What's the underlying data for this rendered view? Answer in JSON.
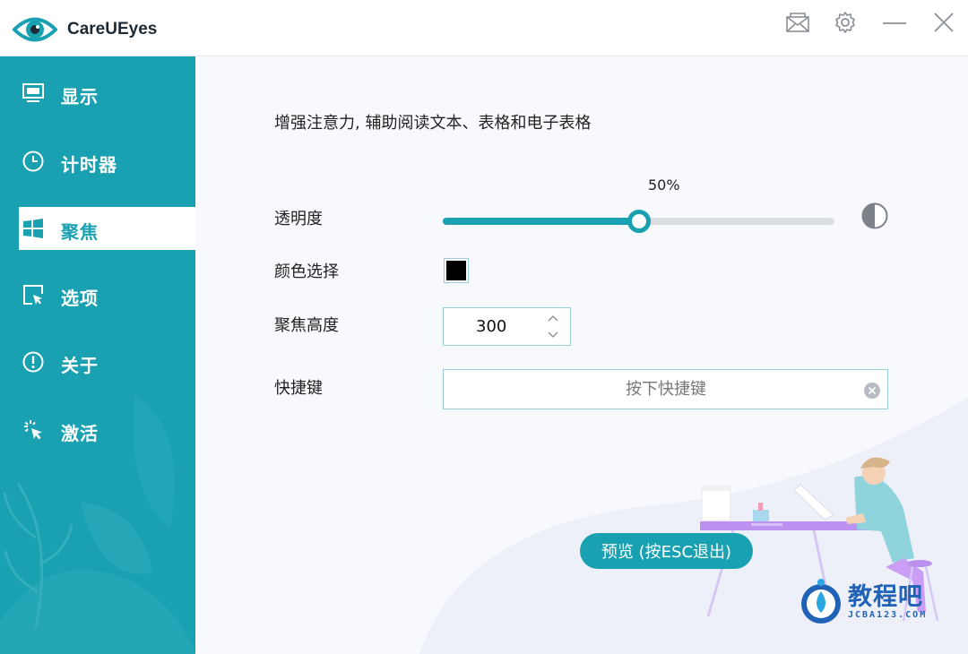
{
  "app": {
    "title": "CareUEyes"
  },
  "titlebar": {
    "icons": [
      "mail-icon",
      "gear-icon",
      "minimize-icon",
      "close-icon"
    ]
  },
  "sidebar": {
    "items": [
      {
        "label": "显示",
        "icon": "monitor-icon",
        "active": false
      },
      {
        "label": "计时器",
        "icon": "clock-icon",
        "active": false
      },
      {
        "label": "聚焦",
        "icon": "windows-icon",
        "active": true
      },
      {
        "label": "选项",
        "icon": "cursor-square-icon",
        "active": false
      },
      {
        "label": "关于",
        "icon": "info-circle-icon",
        "active": false
      },
      {
        "label": "激活",
        "icon": "click-cursor-icon",
        "active": false
      }
    ]
  },
  "main": {
    "description": "增强注意力, 辅助阅读文本、表格和电子表格",
    "opacity": {
      "label": "透明度",
      "value_text": "50%",
      "value": 0.5
    },
    "color": {
      "label": "颜色选择",
      "value": "#000000"
    },
    "focus_height": {
      "label": "聚焦高度",
      "value": "300"
    },
    "hotkey": {
      "label": "快捷键",
      "placeholder": "按下快捷键",
      "value": ""
    },
    "preview_button": "预览 (按ESC退出)"
  },
  "watermark": {
    "name": "教程吧",
    "url": "JCBA123.COM"
  },
  "colors": {
    "accent": "#19a1b2",
    "sidebar": "#19a1b2",
    "panel": "#f8f9fd"
  }
}
